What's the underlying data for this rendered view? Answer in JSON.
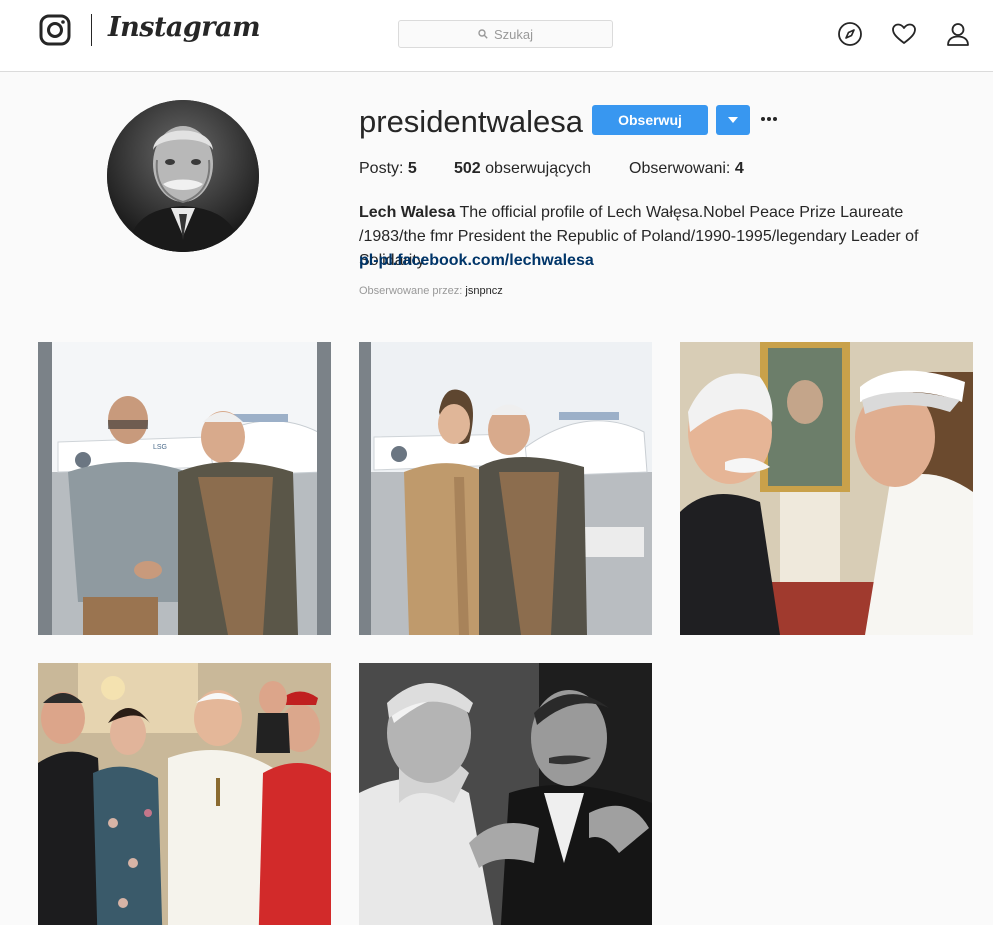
{
  "topnav": {
    "logo_text": "Instagram",
    "search_placeholder": "Szukaj",
    "icons": [
      "instagram-glyph-icon",
      "search-icon",
      "explore-compass-icon",
      "activity-heart-icon",
      "profile-icon"
    ]
  },
  "profile": {
    "username": "presidentwalesa",
    "follow_label": "Obserwuj",
    "stats": {
      "posts_label": "Posty:",
      "posts_count": "5",
      "followers_count": "502",
      "followers_label": "obserwujących",
      "following_label": "Obserwowani:",
      "following_count": "4"
    },
    "bio": {
      "full_name": "Lech Walesa",
      "text": "The official profile of Lech Wałęsa.Nobel Peace Prize Laureate /1983/the fmr President the Republic of Poland/1990-1995/legendary Leader of Solidarity",
      "link": "pl-pl.facebook.com/lechwalesa"
    },
    "followed_by_label": "Obserwowane przez:",
    "followed_by_user": "jsnpncz"
  },
  "colors": {
    "accent": "#3897f0",
    "link": "#003569",
    "background": "#fafafa",
    "border": "#dbdbdb",
    "muted": "#999999"
  }
}
